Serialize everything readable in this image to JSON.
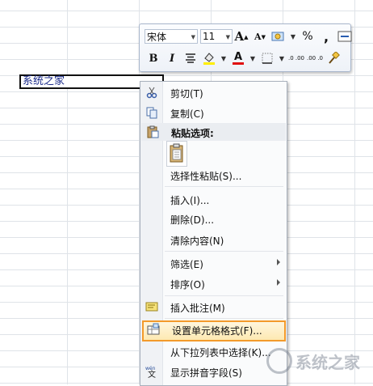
{
  "cell": {
    "value": "系统之家"
  },
  "mini_toolbar": {
    "font_name": "宋体",
    "font_size": "11",
    "grow_font": "A",
    "shrink_font": "A",
    "percent": "%",
    "comma": ",",
    "bold": "B",
    "italic": "I",
    "font_color": "A",
    "inc_decimal": ".0 .00",
    "dec_decimal": ".00 .0"
  },
  "menu": {
    "cut": "剪切(T)",
    "copy": "复制(C)",
    "paste_options": "粘贴选项:",
    "paste_special": "选择性粘贴(S)...",
    "insert": "插入(I)...",
    "delete": "删除(D)...",
    "clear": "清除内容(N)",
    "filter": "筛选(E)",
    "sort": "排序(O)",
    "insert_comment": "插入批注(M)",
    "format_cells": "设置单元格格式(F)...",
    "pick_list": "从下拉列表中选择(K)...",
    "phonetic": "显示拼音字段(S)"
  },
  "watermark": "系统之家"
}
